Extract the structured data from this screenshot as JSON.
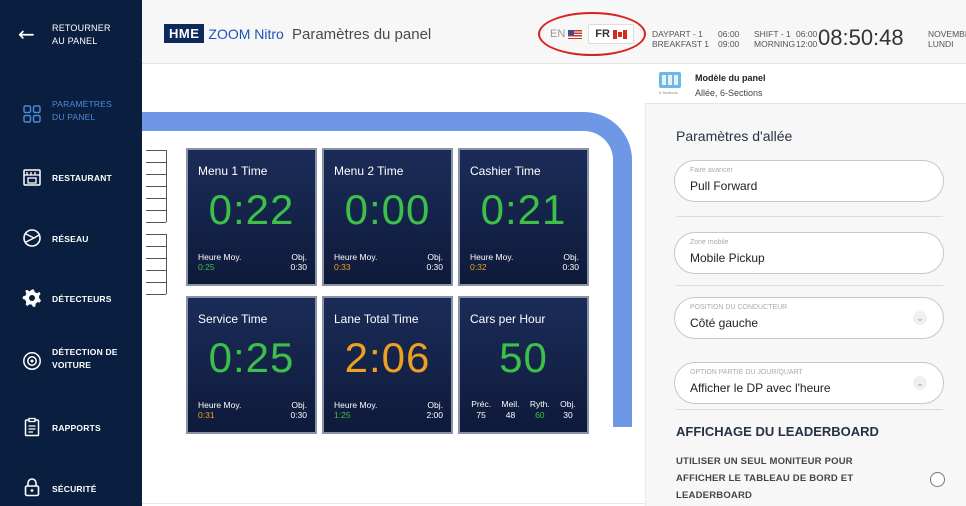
{
  "sidebar": {
    "back_label": "RETOURNER AU PANEL",
    "items": [
      {
        "label": "PARAMÈTRES DU PANEL",
        "icon": "grid-icon"
      },
      {
        "label": "RESTAURANT",
        "icon": "store-icon"
      },
      {
        "label": "RÉSEAU",
        "icon": "network-icon"
      },
      {
        "label": "DÉTECTEURS",
        "icon": "gear-icon"
      },
      {
        "label": "DÉTECTION DE VOITURE",
        "icon": "car-detect-icon"
      },
      {
        "label": "RAPPORTS",
        "icon": "clipboard-icon"
      },
      {
        "label": "SÉCURITÉ",
        "icon": "lock-icon"
      }
    ],
    "colors": {
      "bg": "#0a1f3f",
      "active": "#4a8ad8"
    }
  },
  "header": {
    "logo_hme": "HME",
    "logo_product": "ZOOM Nitro",
    "title": "Paramètres du panel",
    "lang_en": "EN",
    "lang_fr": "FR",
    "daypart_label": "DAYPART - 1",
    "daypart_value": "BREAKFAST 1",
    "daypart_time_start": "06:00",
    "daypart_time_end": "09:00",
    "shift_label": "SHIFT - 1",
    "shift_value": "MORNING",
    "shift_time_start": "06:00",
    "shift_time_end": "12:00",
    "clock": "08:50:48",
    "month": "NOVEMBRE",
    "weekday": "LUNDI"
  },
  "tiles": [
    {
      "title": "Menu 1 Time",
      "value": "0:22",
      "avg_label": "Heure Moy.",
      "avg_value": "0:25",
      "goal_label": "Obj.",
      "goal_value": "0:30",
      "value_color": "green",
      "avg_color": "green"
    },
    {
      "title": "Menu 2 Time",
      "value": "0:00",
      "avg_label": "Heure Moy.",
      "avg_value": "0:33",
      "goal_label": "Obj.",
      "goal_value": "0:30",
      "value_color": "green",
      "avg_color": "orange"
    },
    {
      "title": "Cashier Time",
      "value": "0:21",
      "avg_label": "Heure Moy.",
      "avg_value": "0:32",
      "goal_label": "Obj.",
      "goal_value": "0:30",
      "value_color": "green",
      "avg_color": "orange"
    },
    {
      "title": "Service Time",
      "value": "0:25",
      "avg_label": "Heure Moy.",
      "avg_value": "0:31",
      "goal_label": "Obj.",
      "goal_value": "0:30",
      "value_color": "green",
      "avg_color": "orange"
    },
    {
      "title": "Lane Total Time",
      "value": "2:06",
      "avg_label": "Heure Moy.",
      "avg_value": "1:25",
      "goal_label": "Obj.",
      "goal_value": "2:00",
      "value_color": "orange",
      "avg_color": "green"
    }
  ],
  "cars_tile": {
    "title": "Cars per Hour",
    "value": "50",
    "cols": [
      {
        "label": "Préc.",
        "value": "75"
      },
      {
        "label": "Meil.",
        "value": "48"
      },
      {
        "label": "Ryth.",
        "value": "60"
      },
      {
        "label": "Obj.",
        "value": "30"
      }
    ]
  },
  "right_panel": {
    "model_title": "Modèle du panel",
    "model_value": "Allée, 6-Sections",
    "model_icon_caption": "6 Sections",
    "section_title": "Paramètres d'allée",
    "fields": [
      {
        "label": "Faire avancer",
        "value": "Pull Forward"
      },
      {
        "label": "Zone mobile",
        "value": "Mobile Pickup"
      },
      {
        "label": "POSITION DU CONDUCTEUR",
        "value": "Côté gauche"
      },
      {
        "label": "OPTION PARTIE DU JOUR/QUART",
        "value": "Afficher le DP avec l'heure"
      }
    ],
    "leaderboard_title": "AFFICHAGE DU LEADERBOARD",
    "leaderboard_text": "UTILISER UN SEUL MONITEUR POUR AFFICHER LE TABLEAU DE BORD ET LEADERBOARD"
  },
  "colors": {
    "green": "#3cc04a",
    "orange": "#f0a020",
    "lane": "#6e98e6",
    "tile_bg": "#14234a",
    "annotation_red": "#d82020"
  }
}
